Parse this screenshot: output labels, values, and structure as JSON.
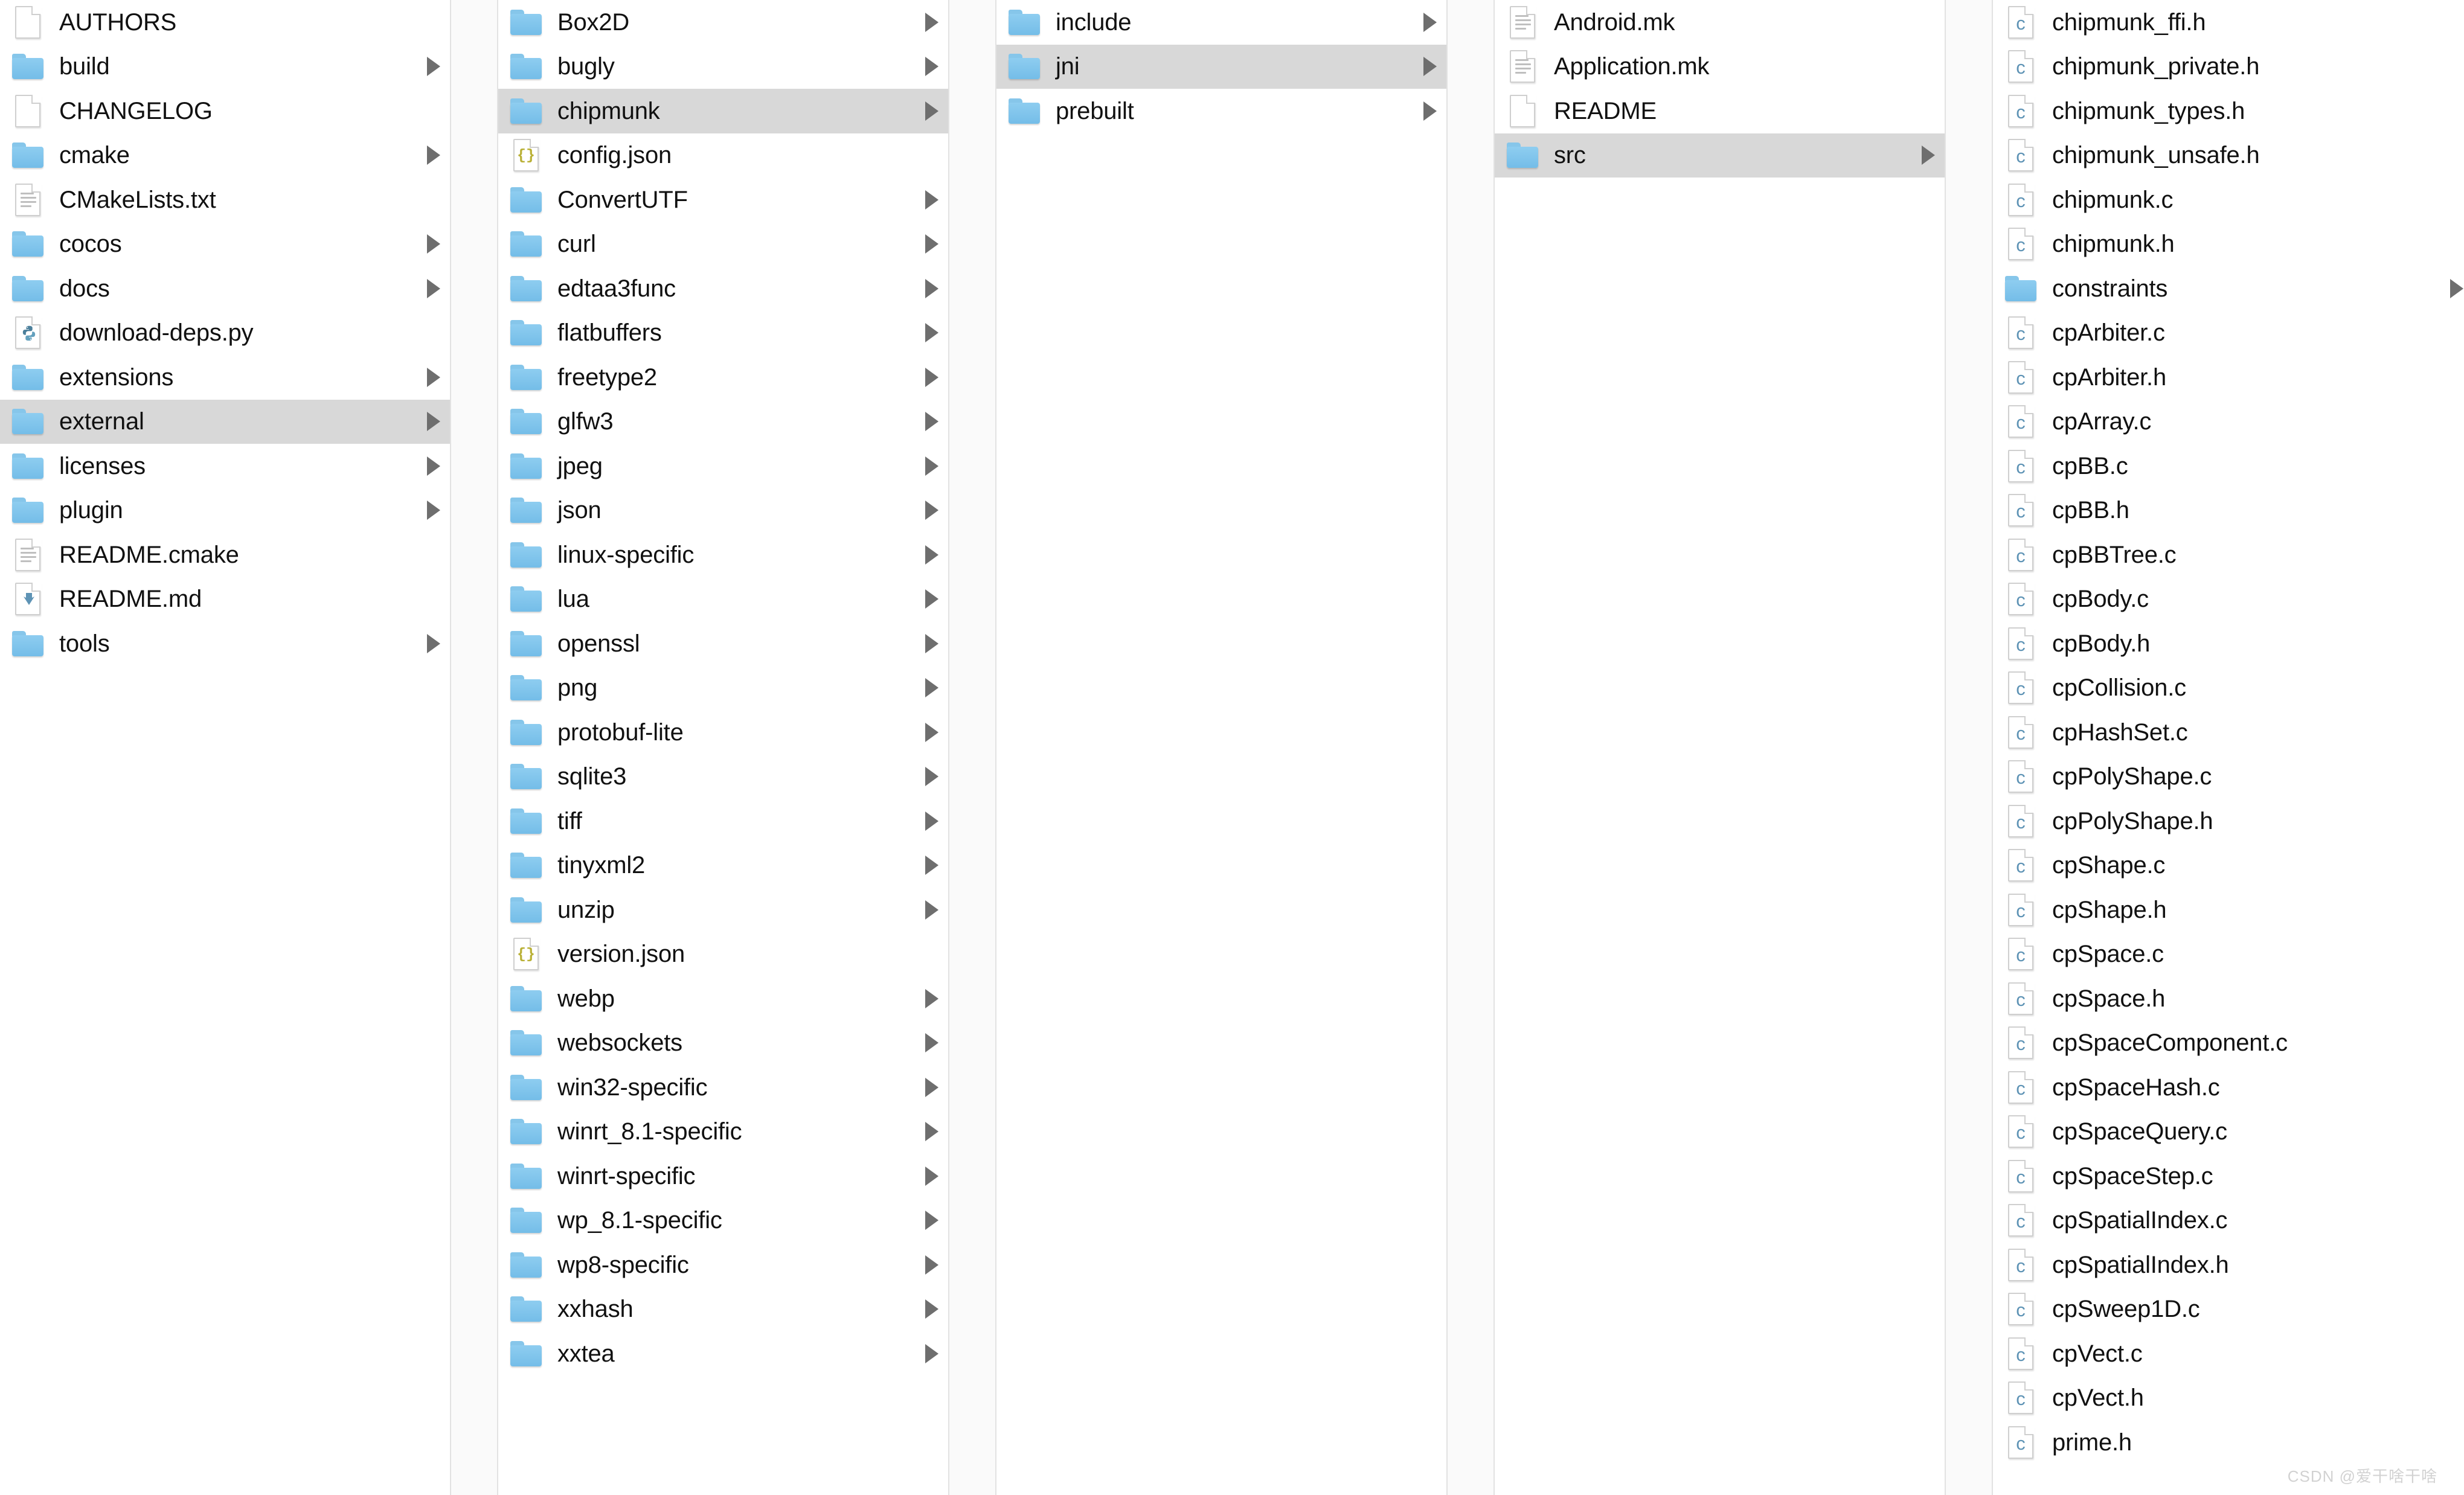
{
  "app": {
    "name": "Finder",
    "view": "column-view",
    "selection_color": "#d8d8d8",
    "folder_color": "#7ec2e8",
    "c_file_accent": "#5e93b5"
  },
  "watermark": {
    "text": "CSDN @爱干啥干啥"
  },
  "columns": [
    {
      "id": "col-root",
      "items": [
        {
          "name": "AUTHORS",
          "icon": "blank-document-icon",
          "kind": "file",
          "arrow": false,
          "selected": false
        },
        {
          "name": "build",
          "icon": "folder-icon",
          "kind": "folder",
          "arrow": true,
          "selected": false
        },
        {
          "name": "CHANGELOG",
          "icon": "blank-document-icon",
          "kind": "file",
          "arrow": false,
          "selected": false
        },
        {
          "name": "cmake",
          "icon": "folder-icon",
          "kind": "folder",
          "arrow": true,
          "selected": false
        },
        {
          "name": "CMakeLists.txt",
          "icon": "text-document-icon",
          "kind": "file",
          "arrow": false,
          "selected": false
        },
        {
          "name": "cocos",
          "icon": "folder-icon",
          "kind": "folder",
          "arrow": true,
          "selected": false
        },
        {
          "name": "docs",
          "icon": "folder-icon",
          "kind": "folder",
          "arrow": true,
          "selected": false
        },
        {
          "name": "download-deps.py",
          "icon": "python-file-icon",
          "kind": "file",
          "arrow": false,
          "selected": false
        },
        {
          "name": "extensions",
          "icon": "folder-icon",
          "kind": "folder",
          "arrow": true,
          "selected": false
        },
        {
          "name": "external",
          "icon": "folder-icon",
          "kind": "folder",
          "arrow": true,
          "selected": true
        },
        {
          "name": "licenses",
          "icon": "folder-icon",
          "kind": "folder",
          "arrow": true,
          "selected": false
        },
        {
          "name": "plugin",
          "icon": "folder-icon",
          "kind": "folder",
          "arrow": true,
          "selected": false
        },
        {
          "name": "README.cmake",
          "icon": "text-document-icon",
          "kind": "file",
          "arrow": false,
          "selected": false
        },
        {
          "name": "README.md",
          "icon": "markdown-file-icon",
          "kind": "file",
          "arrow": false,
          "selected": false
        },
        {
          "name": "tools",
          "icon": "folder-icon",
          "kind": "folder",
          "arrow": true,
          "selected": false
        }
      ]
    },
    {
      "id": "col-external",
      "items": [
        {
          "name": "Box2D",
          "icon": "folder-icon",
          "kind": "folder",
          "arrow": true,
          "selected": false
        },
        {
          "name": "bugly",
          "icon": "folder-icon",
          "kind": "folder",
          "arrow": true,
          "selected": false
        },
        {
          "name": "chipmunk",
          "icon": "folder-icon",
          "kind": "folder",
          "arrow": true,
          "selected": true
        },
        {
          "name": "config.json",
          "icon": "json-file-icon",
          "kind": "file",
          "arrow": false,
          "selected": false
        },
        {
          "name": "ConvertUTF",
          "icon": "folder-icon",
          "kind": "folder",
          "arrow": true,
          "selected": false
        },
        {
          "name": "curl",
          "icon": "folder-icon",
          "kind": "folder",
          "arrow": true,
          "selected": false
        },
        {
          "name": "edtaa3func",
          "icon": "folder-icon",
          "kind": "folder",
          "arrow": true,
          "selected": false
        },
        {
          "name": "flatbuffers",
          "icon": "folder-icon",
          "kind": "folder",
          "arrow": true,
          "selected": false
        },
        {
          "name": "freetype2",
          "icon": "folder-icon",
          "kind": "folder",
          "arrow": true,
          "selected": false
        },
        {
          "name": "glfw3",
          "icon": "folder-icon",
          "kind": "folder",
          "arrow": true,
          "selected": false
        },
        {
          "name": "jpeg",
          "icon": "folder-icon",
          "kind": "folder",
          "arrow": true,
          "selected": false
        },
        {
          "name": "json",
          "icon": "folder-icon",
          "kind": "folder",
          "arrow": true,
          "selected": false
        },
        {
          "name": "linux-specific",
          "icon": "folder-icon",
          "kind": "folder",
          "arrow": true,
          "selected": false
        },
        {
          "name": "lua",
          "icon": "folder-icon",
          "kind": "folder",
          "arrow": true,
          "selected": false
        },
        {
          "name": "openssl",
          "icon": "folder-icon",
          "kind": "folder",
          "arrow": true,
          "selected": false
        },
        {
          "name": "png",
          "icon": "folder-icon",
          "kind": "folder",
          "arrow": true,
          "selected": false
        },
        {
          "name": "protobuf-lite",
          "icon": "folder-icon",
          "kind": "folder",
          "arrow": true,
          "selected": false
        },
        {
          "name": "sqlite3",
          "icon": "folder-icon",
          "kind": "folder",
          "arrow": true,
          "selected": false
        },
        {
          "name": "tiff",
          "icon": "folder-icon",
          "kind": "folder",
          "arrow": true,
          "selected": false
        },
        {
          "name": "tinyxml2",
          "icon": "folder-icon",
          "kind": "folder",
          "arrow": true,
          "selected": false
        },
        {
          "name": "unzip",
          "icon": "folder-icon",
          "kind": "folder",
          "arrow": true,
          "selected": false
        },
        {
          "name": "version.json",
          "icon": "json-file-icon",
          "kind": "file",
          "arrow": false,
          "selected": false
        },
        {
          "name": "webp",
          "icon": "folder-icon",
          "kind": "folder",
          "arrow": true,
          "selected": false
        },
        {
          "name": "websockets",
          "icon": "folder-icon",
          "kind": "folder",
          "arrow": true,
          "selected": false
        },
        {
          "name": "win32-specific",
          "icon": "folder-icon",
          "kind": "folder",
          "arrow": true,
          "selected": false
        },
        {
          "name": "winrt_8.1-specific",
          "icon": "folder-icon",
          "kind": "folder",
          "arrow": true,
          "selected": false
        },
        {
          "name": "winrt-specific",
          "icon": "folder-icon",
          "kind": "folder",
          "arrow": true,
          "selected": false
        },
        {
          "name": "wp_8.1-specific",
          "icon": "folder-icon",
          "kind": "folder",
          "arrow": true,
          "selected": false
        },
        {
          "name": "wp8-specific",
          "icon": "folder-icon",
          "kind": "folder",
          "arrow": true,
          "selected": false
        },
        {
          "name": "xxhash",
          "icon": "folder-icon",
          "kind": "folder",
          "arrow": true,
          "selected": false
        },
        {
          "name": "xxtea",
          "icon": "folder-icon",
          "kind": "folder",
          "arrow": true,
          "selected": false
        }
      ]
    },
    {
      "id": "col-chipmunk",
      "items": [
        {
          "name": "include",
          "icon": "folder-icon",
          "kind": "folder",
          "arrow": true,
          "selected": false
        },
        {
          "name": "jni",
          "icon": "folder-icon",
          "kind": "folder",
          "arrow": true,
          "selected": true
        },
        {
          "name": "prebuilt",
          "icon": "folder-icon",
          "kind": "folder",
          "arrow": true,
          "selected": false
        }
      ]
    },
    {
      "id": "col-jni",
      "items": [
        {
          "name": "Android.mk",
          "icon": "text-document-icon",
          "kind": "file",
          "arrow": false,
          "selected": false
        },
        {
          "name": "Application.mk",
          "icon": "text-document-icon",
          "kind": "file",
          "arrow": false,
          "selected": false
        },
        {
          "name": "README",
          "icon": "blank-document-icon",
          "kind": "file",
          "arrow": false,
          "selected": false
        },
        {
          "name": "src",
          "icon": "folder-icon",
          "kind": "folder",
          "arrow": true,
          "selected": true
        }
      ]
    },
    {
      "id": "col-src",
      "items": [
        {
          "name": "chipmunk_ffi.h",
          "icon": "c-file-icon",
          "kind": "file",
          "arrow": false,
          "selected": false
        },
        {
          "name": "chipmunk_private.h",
          "icon": "c-file-icon",
          "kind": "file",
          "arrow": false,
          "selected": false
        },
        {
          "name": "chipmunk_types.h",
          "icon": "c-file-icon",
          "kind": "file",
          "arrow": false,
          "selected": false
        },
        {
          "name": "chipmunk_unsafe.h",
          "icon": "c-file-icon",
          "kind": "file",
          "arrow": false,
          "selected": false
        },
        {
          "name": "chipmunk.c",
          "icon": "c-file-icon",
          "kind": "file",
          "arrow": false,
          "selected": false
        },
        {
          "name": "chipmunk.h",
          "icon": "c-file-icon",
          "kind": "file",
          "arrow": false,
          "selected": false
        },
        {
          "name": "constraints",
          "icon": "folder-icon",
          "kind": "folder",
          "arrow": true,
          "selected": false
        },
        {
          "name": "cpArbiter.c",
          "icon": "c-file-icon",
          "kind": "file",
          "arrow": false,
          "selected": false
        },
        {
          "name": "cpArbiter.h",
          "icon": "c-file-icon",
          "kind": "file",
          "arrow": false,
          "selected": false
        },
        {
          "name": "cpArray.c",
          "icon": "c-file-icon",
          "kind": "file",
          "arrow": false,
          "selected": false
        },
        {
          "name": "cpBB.c",
          "icon": "c-file-icon",
          "kind": "file",
          "arrow": false,
          "selected": false
        },
        {
          "name": "cpBB.h",
          "icon": "c-file-icon",
          "kind": "file",
          "arrow": false,
          "selected": false
        },
        {
          "name": "cpBBTree.c",
          "icon": "c-file-icon",
          "kind": "file",
          "arrow": false,
          "selected": false
        },
        {
          "name": "cpBody.c",
          "icon": "c-file-icon",
          "kind": "file",
          "arrow": false,
          "selected": false
        },
        {
          "name": "cpBody.h",
          "icon": "c-file-icon",
          "kind": "file",
          "arrow": false,
          "selected": false
        },
        {
          "name": "cpCollision.c",
          "icon": "c-file-icon",
          "kind": "file",
          "arrow": false,
          "selected": false
        },
        {
          "name": "cpHashSet.c",
          "icon": "c-file-icon",
          "kind": "file",
          "arrow": false,
          "selected": false
        },
        {
          "name": "cpPolyShape.c",
          "icon": "c-file-icon",
          "kind": "file",
          "arrow": false,
          "selected": false
        },
        {
          "name": "cpPolyShape.h",
          "icon": "c-file-icon",
          "kind": "file",
          "arrow": false,
          "selected": false
        },
        {
          "name": "cpShape.c",
          "icon": "c-file-icon",
          "kind": "file",
          "arrow": false,
          "selected": false
        },
        {
          "name": "cpShape.h",
          "icon": "c-file-icon",
          "kind": "file",
          "arrow": false,
          "selected": false
        },
        {
          "name": "cpSpace.c",
          "icon": "c-file-icon",
          "kind": "file",
          "arrow": false,
          "selected": false
        },
        {
          "name": "cpSpace.h",
          "icon": "c-file-icon",
          "kind": "file",
          "arrow": false,
          "selected": false
        },
        {
          "name": "cpSpaceComponent.c",
          "icon": "c-file-icon",
          "kind": "file",
          "arrow": false,
          "selected": false
        },
        {
          "name": "cpSpaceHash.c",
          "icon": "c-file-icon",
          "kind": "file",
          "arrow": false,
          "selected": false
        },
        {
          "name": "cpSpaceQuery.c",
          "icon": "c-file-icon",
          "kind": "file",
          "arrow": false,
          "selected": false
        },
        {
          "name": "cpSpaceStep.c",
          "icon": "c-file-icon",
          "kind": "file",
          "arrow": false,
          "selected": false
        },
        {
          "name": "cpSpatialIndex.c",
          "icon": "c-file-icon",
          "kind": "file",
          "arrow": false,
          "selected": false
        },
        {
          "name": "cpSpatialIndex.h",
          "icon": "c-file-icon",
          "kind": "file",
          "arrow": false,
          "selected": false
        },
        {
          "name": "cpSweep1D.c",
          "icon": "c-file-icon",
          "kind": "file",
          "arrow": false,
          "selected": false
        },
        {
          "name": "cpVect.c",
          "icon": "c-file-icon",
          "kind": "file",
          "arrow": false,
          "selected": false
        },
        {
          "name": "cpVect.h",
          "icon": "c-file-icon",
          "kind": "file",
          "arrow": false,
          "selected": false
        },
        {
          "name": "prime.h",
          "icon": "c-file-icon",
          "kind": "file",
          "arrow": false,
          "selected": false
        }
      ]
    }
  ]
}
